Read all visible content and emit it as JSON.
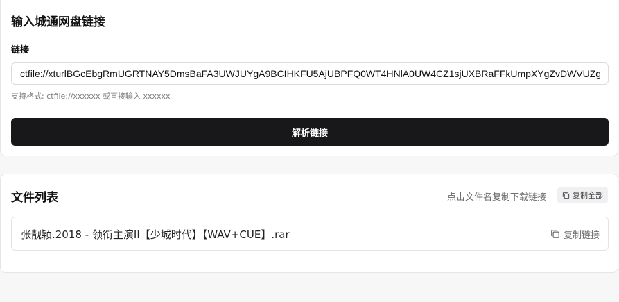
{
  "input_section": {
    "title": "输入城通网盘链接",
    "field_label": "链接",
    "link_value": "ctfile://xturlBGcEbgRmUGRTNAY5DmsBaFA3UWJUYgA9BCIHKFU5AjUBPFQ0WT4HNlA0UW4CZ1sjUXBRaFFkUmpXYgZvDWVUZg",
    "hint": "支持格式: ctfile://xxxxxx 或直接输入 xxxxxx",
    "parse_button": "解析链接"
  },
  "file_section": {
    "title": "文件列表",
    "hint": "点击文件名复制下载链接",
    "copy_all_label": "复制全部",
    "files": [
      {
        "name": "张靓颖.2018 - 领衔主演II【少城时代】【WAV+CUE】.rar",
        "copy_label": "复制链接"
      }
    ]
  },
  "icons": {
    "copy_all": "copy-icon",
    "copy_link": "copy-icon"
  }
}
